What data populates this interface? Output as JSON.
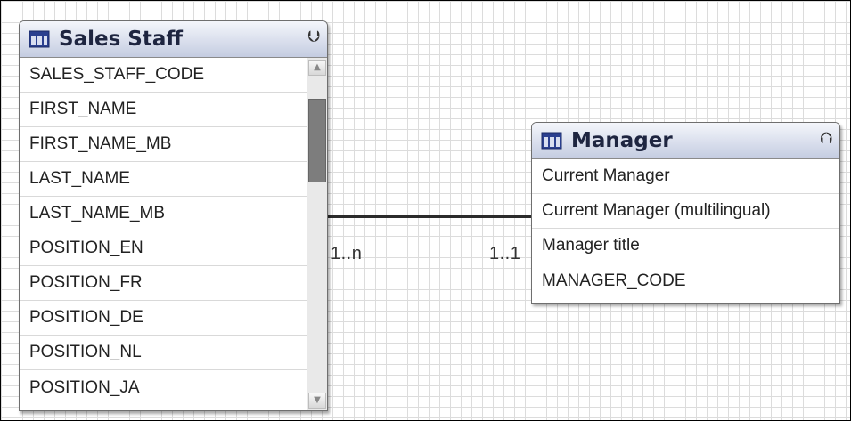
{
  "relationship": {
    "left_cardinality": "1..n",
    "right_cardinality": "1..1"
  },
  "sales_staff": {
    "title": "Sales Staff",
    "collapse_icon": "chevron-double-down-icon",
    "attributes": [
      "SALES_STAFF_CODE",
      "FIRST_NAME",
      "FIRST_NAME_MB",
      "LAST_NAME",
      "LAST_NAME_MB",
      "POSITION_EN",
      "POSITION_FR",
      "POSITION_DE",
      "POSITION_NL",
      "POSITION_JA"
    ]
  },
  "manager": {
    "title": "Manager",
    "collapse_icon": "chevron-double-up-icon",
    "attributes": [
      "Current Manager",
      "Current Manager (multilingual)",
      "Manager title",
      "MANAGER_CODE"
    ]
  },
  "colors": {
    "header_text": "#1e2540",
    "relationship_line": "#2b2b2b",
    "grid": "#dcdcdc"
  }
}
